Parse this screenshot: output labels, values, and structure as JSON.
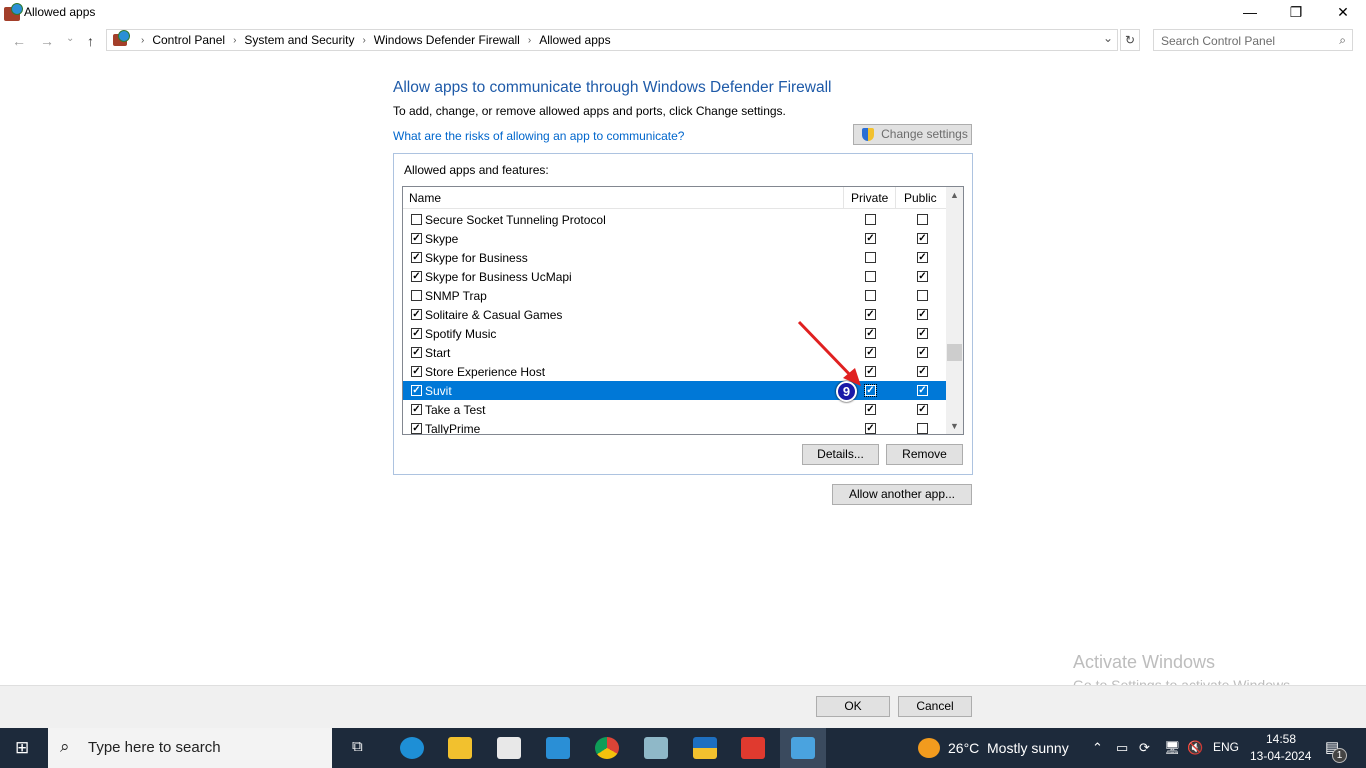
{
  "window": {
    "title": "Allowed apps",
    "minimize": "—",
    "restore": "❐",
    "close": "✕"
  },
  "nav": {
    "back": "←",
    "forward": "→",
    "recent": "⌄",
    "up": "↑",
    "breadcrumb": [
      "Control Panel",
      "System and Security",
      "Windows Defender Firewall",
      "Allowed apps"
    ],
    "dropdown": "⌄",
    "refresh": "↻",
    "search_placeholder": "Search Control Panel"
  },
  "main": {
    "heading": "Allow apps to communicate through Windows Defender Firewall",
    "subtitle": "To add, change, or remove allowed apps and ports, click Change settings.",
    "risk_link": "What are the risks of allowing an app to communicate?",
    "change_settings": "Change settings",
    "group_label": "Allowed apps and features:",
    "columns": {
      "name": "Name",
      "private": "Private",
      "public": "Public"
    },
    "rows": [
      {
        "name": "Secure Socket Tunneling Protocol",
        "enabled": false,
        "private": false,
        "public": false
      },
      {
        "name": "Skype",
        "enabled": true,
        "private": true,
        "public": true
      },
      {
        "name": "Skype for Business",
        "enabled": true,
        "private": false,
        "public": true
      },
      {
        "name": "Skype for Business UcMapi",
        "enabled": true,
        "private": false,
        "public": true
      },
      {
        "name": "SNMP Trap",
        "enabled": false,
        "private": false,
        "public": false
      },
      {
        "name": "Solitaire & Casual Games",
        "enabled": true,
        "private": true,
        "public": true
      },
      {
        "name": "Spotify Music",
        "enabled": true,
        "private": true,
        "public": true
      },
      {
        "name": "Start",
        "enabled": true,
        "private": true,
        "public": true
      },
      {
        "name": "Store Experience Host",
        "enabled": true,
        "private": true,
        "public": true
      },
      {
        "name": "Suvit",
        "enabled": true,
        "private": true,
        "public": true,
        "selected": true
      },
      {
        "name": "Take a Test",
        "enabled": true,
        "private": true,
        "public": true
      },
      {
        "name": "TallyPrime",
        "enabled": true,
        "private": true,
        "public": false
      }
    ],
    "details": "Details...",
    "remove": "Remove",
    "allow_another": "Allow another app...",
    "step_marker": "9"
  },
  "footer": {
    "ok": "OK",
    "cancel": "Cancel"
  },
  "watermark": {
    "line1": "Activate Windows",
    "line2": "Go to Settings to activate Windows."
  },
  "taskbar": {
    "search_placeholder": "Type here to search",
    "weather_temp": "26°C",
    "weather_text": "Mostly sunny",
    "lang": "ENG",
    "time": "14:58",
    "date": "13-04-2024",
    "notifications": "1"
  },
  "colors": {
    "accent": "#0078d7",
    "link": "#0066cc",
    "heading": "#1e5aa8",
    "taskbar": "#1d2a3b"
  }
}
